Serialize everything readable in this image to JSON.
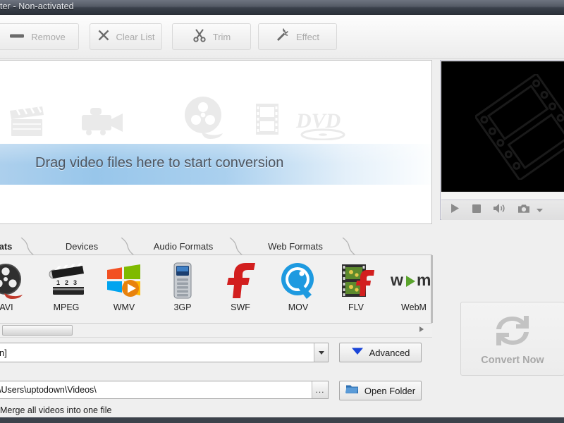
{
  "window": {
    "title": "ter - Non-activated"
  },
  "toolbar": {
    "buttons": [
      {
        "label": "Remove",
        "icon": "minus-icon",
        "enabled": false
      },
      {
        "label": "Clear List",
        "icon": "x-icon",
        "enabled": false
      },
      {
        "label": "Trim",
        "icon": "scissors-icon",
        "enabled": false
      },
      {
        "label": "Effect",
        "icon": "wand-icon",
        "enabled": false
      }
    ]
  },
  "file_list": {
    "drop_text": "Drag video files here to start conversion",
    "watermark_icons": [
      "clapperboard-icon",
      "camcorder-icon",
      "film-reel-icon",
      "filmstrip-icon",
      "dvd-icon"
    ]
  },
  "preview": {
    "watermark_icon": "filmstrip-watermark-icon",
    "controls": [
      {
        "name": "play-icon",
        "label": "Play"
      },
      {
        "name": "stop-icon",
        "label": "Stop"
      },
      {
        "name": "volume-icon",
        "label": "Volume"
      },
      {
        "name": "snapshot-icon",
        "label": "Snapshot"
      },
      {
        "name": "chevron-down-icon",
        "label": "Snapshot options"
      }
    ]
  },
  "format_tabs": [
    {
      "label": "ats",
      "active": true
    },
    {
      "label": "Devices",
      "active": false
    },
    {
      "label": "Audio Formats",
      "active": false
    },
    {
      "label": "Web Formats",
      "active": false
    }
  ],
  "formats": [
    {
      "label": "AVI",
      "icon": "avi-reel-icon"
    },
    {
      "label": "MPEG",
      "icon": "mpeg-clapper-icon"
    },
    {
      "label": "WMV",
      "icon": "wmv-windows-icon"
    },
    {
      "label": "3GP",
      "icon": "3gp-phone-icon"
    },
    {
      "label": "SWF",
      "icon": "swf-flash-icon"
    },
    {
      "label": "MOV",
      "icon": "mov-quicktime-icon"
    },
    {
      "label": "FLV",
      "icon": "flv-film-icon"
    },
    {
      "label": "WebM",
      "icon": "webm-icon"
    }
  ],
  "profile": {
    "value": "n]",
    "advanced_label": "Advanced",
    "advanced_icon": "triangle-down-icon"
  },
  "output": {
    "path": "\\Users\\uptodown\\Videos\\",
    "browse_label": "...",
    "open_folder_label": "Open Folder",
    "open_folder_icon": "folder-icon",
    "merge_label": "Merge all videos into one file"
  },
  "convert": {
    "label": "Convert Now",
    "icon": "refresh-circular-arrows-icon",
    "enabled": false
  },
  "colors": {
    "titlebar_dark": "#2b313a",
    "drop_band_blue": "#96c5ea",
    "accent_blue": "#1a45d8",
    "disabled_text": "#a9a9a9"
  }
}
